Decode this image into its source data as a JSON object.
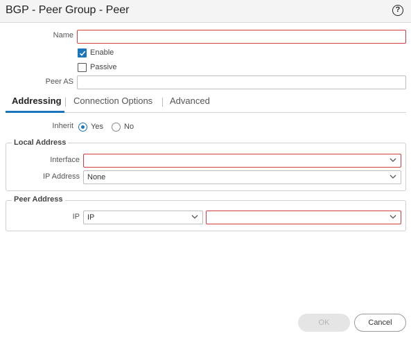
{
  "dialog": {
    "title": "BGP - Peer Group - Peer",
    "help_glyph": "?"
  },
  "form": {
    "name_label": "Name",
    "name_value": "",
    "enable_label": "Enable",
    "enable_checked": true,
    "passive_label": "Passive",
    "passive_checked": false,
    "peer_as_label": "Peer AS",
    "peer_as_value": ""
  },
  "tabs": [
    {
      "label": "Addressing",
      "active": true
    },
    {
      "label": "Connection Options",
      "active": false
    },
    {
      "label": "Advanced",
      "active": false
    }
  ],
  "addressing": {
    "inherit_label": "Inherit",
    "inherit_options": [
      {
        "label": "Yes",
        "selected": true
      },
      {
        "label": "No",
        "selected": false
      }
    ],
    "local_address": {
      "legend": "Local Address",
      "interface_label": "Interface",
      "interface_value": "",
      "ip_address_label": "IP Address",
      "ip_address_value": "None"
    },
    "peer_address": {
      "legend": "Peer Address",
      "ip_label": "IP",
      "ip_type_value": "IP",
      "ip_value": ""
    }
  },
  "footer": {
    "ok_label": "OK",
    "cancel_label": "Cancel"
  },
  "colors": {
    "accent": "#1b75bb",
    "required_border": "#d23c3c"
  }
}
